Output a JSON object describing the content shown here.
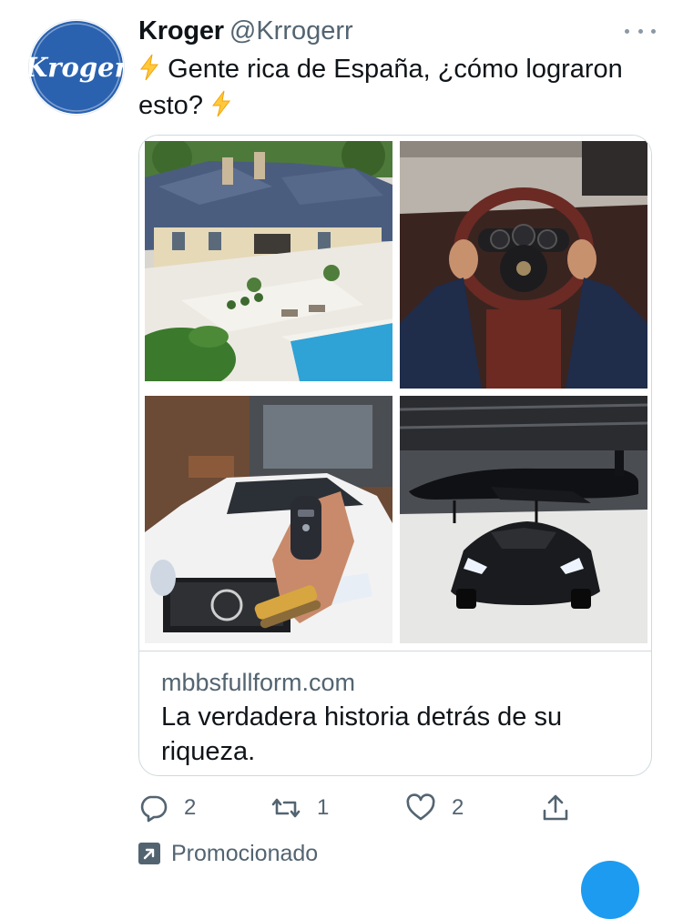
{
  "account": {
    "name": "Kroger",
    "handle": "@Krrogerr",
    "avatar_text": "Kroger"
  },
  "tweet": {
    "text": "Gente rica de España, ¿cómo lograron esto?",
    "emoji": "high-voltage"
  },
  "card": {
    "domain": "mbbsfullform.com",
    "title": "La verdadera historia detrás de su riqueza."
  },
  "actions": {
    "reply_count": "2",
    "retweet_count": "1",
    "like_count": "2"
  },
  "promoted_label": "Promocionado",
  "colors": {
    "brand_blue": "#2a62b0",
    "text_secondary": "#536471",
    "accent": "#1d9bf0"
  }
}
